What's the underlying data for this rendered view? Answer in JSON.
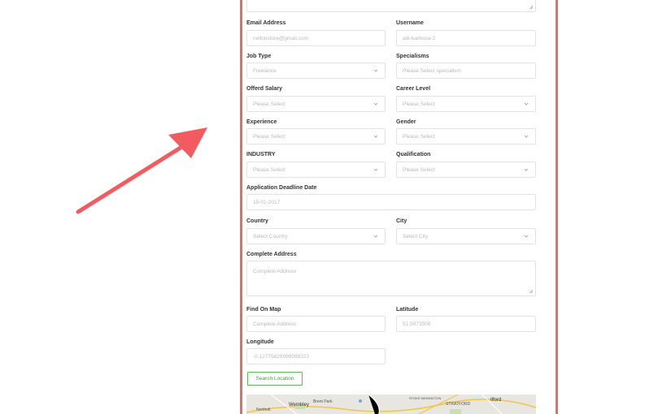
{
  "form": {
    "email": {
      "label": "Email Address",
      "value": "nellonstore@gmail.com"
    },
    "username": {
      "label": "Username",
      "value": "adi-barbosa-2"
    },
    "job_type": {
      "label": "Job Type",
      "value": "Freelance"
    },
    "specialisms": {
      "label": "Specialisms",
      "placeholder": "Please Select specialism"
    },
    "offered_salary": {
      "label": "Offerd Salary",
      "value": "Please Select"
    },
    "career_level": {
      "label": "Career Level",
      "value": "Please Select"
    },
    "experience": {
      "label": "Experience",
      "value": "Please Select"
    },
    "gender": {
      "label": "Gender",
      "value": "Please Select"
    },
    "industry": {
      "label": "INDUSTRY",
      "value": "Please Select"
    },
    "qualification": {
      "label": "Qualification",
      "value": "Please Select"
    },
    "deadline": {
      "label": "Application Deadline Date",
      "value": "15-01-2017"
    },
    "country": {
      "label": "Country",
      "value": "Select Country"
    },
    "city": {
      "label": "City",
      "value": "Select City"
    },
    "address": {
      "label": "Complete Address",
      "placeholder": "Complete Address"
    },
    "find_on_map": {
      "label": "Find On Map",
      "placeholder": "Complete Address"
    },
    "latitude": {
      "label": "Latitude",
      "value": "51.5073509"
    },
    "longitude": {
      "label": "Longitude",
      "value": "-0.12775829999998223"
    },
    "search_button": "Search Location"
  },
  "map": {
    "labels": [
      "Wembley",
      "Brent Park",
      "Northolt",
      "STOKE NEWINGTON",
      "STRATFORD",
      "Ilford"
    ]
  },
  "colors": {
    "accent": "#ea6b5c",
    "button": "#5cb85c",
    "arrow": "#f25c60"
  }
}
